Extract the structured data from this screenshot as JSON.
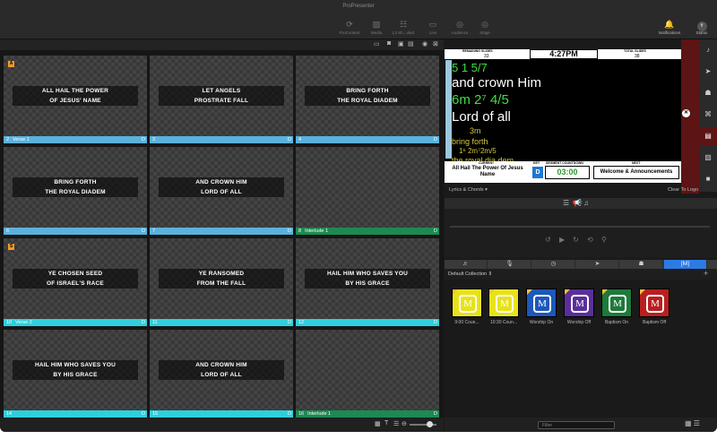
{
  "app_title": "ProPresenter",
  "toolbar": [
    {
      "label": "ProContent",
      "icon": "procontent-icon",
      "glyph": "⟳"
    },
    {
      "label": "Media",
      "icon": "media-icon",
      "glyph": "▨"
    },
    {
      "label": "L3 Sh...uled",
      "icon": "scheduled-icon",
      "glyph": "☷"
    },
    {
      "label": "Live",
      "icon": "live-icon",
      "glyph": "▭"
    },
    {
      "label": "Audience",
      "icon": "audience-icon",
      "glyph": "◎"
    },
    {
      "label": "Stage",
      "icon": "stage-icon",
      "glyph": "◎"
    }
  ],
  "toolbar_right": [
    {
      "label": "Notifications",
      "icon": "notifications-bell-icon",
      "glyph": "🔔"
    },
    {
      "label": "Status",
      "icon": "status-avatar-icon",
      "glyph": "ff"
    }
  ],
  "slides": [
    {
      "lines": [
        "ALL HAIL THE POWER",
        "OF JESUS' NAME"
      ],
      "index": "2",
      "group": "Verse 1",
      "color": "bl",
      "marker": "A"
    },
    {
      "lines": [
        "LET ANGELS",
        "PROSTRATE FALL"
      ],
      "index": "3",
      "group": "",
      "color": "bl",
      "marker": ""
    },
    {
      "lines": [
        "BRING FORTH",
        "THE ROYAL DIADEM"
      ],
      "index": "4",
      "group": "",
      "color": "bl",
      "marker": ""
    },
    {
      "lines": [
        "BRING FORTH",
        "THE ROYAL DIADEM"
      ],
      "index": "6",
      "group": "",
      "color": "bl",
      "marker": ""
    },
    {
      "lines": [
        "AND CROWN HIM",
        "LORD OF ALL"
      ],
      "index": "7",
      "group": "",
      "color": "bl",
      "marker": ""
    },
    {
      "lines": [],
      "index": "8",
      "group": "Interlude 1",
      "color": "gr",
      "marker": ""
    },
    {
      "lines": [
        "YE CHOSEN SEED",
        "OF ISRAEL'S RACE"
      ],
      "index": "10",
      "group": "Verse 2",
      "color": "cy",
      "marker": "S"
    },
    {
      "lines": [
        "YE RANSOMED",
        "FROM THE FALL"
      ],
      "index": "11",
      "group": "",
      "color": "cy",
      "marker": ""
    },
    {
      "lines": [
        "HAIL HIM WHO SAVES YOU",
        "BY HIS GRACE"
      ],
      "index": "12",
      "group": "",
      "color": "cy",
      "marker": ""
    },
    {
      "lines": [
        "HAIL HIM WHO SAVES YOU",
        "BY HIS GRACE"
      ],
      "index": "14",
      "group": "",
      "color": "cy",
      "marker": ""
    },
    {
      "lines": [
        "AND CROWN HIM",
        "LORD OF ALL"
      ],
      "index": "15",
      "group": "",
      "color": "cy",
      "marker": ""
    },
    {
      "lines": [],
      "index": "16",
      "group": "Interlude 1",
      "color": "gr",
      "marker": ""
    }
  ],
  "slide_badge": "D",
  "stage": {
    "remaining_label": "REMAINING SLIDES",
    "remaining_value": "33",
    "clock": "4:27PM",
    "total_label": "TOTAL SLIDES",
    "total_value": "38",
    "lines": [
      {
        "text": "5    1         5/7",
        "color": "#3ee03e"
      },
      {
        "text": "and crown Him",
        "color": "#ffffff"
      },
      {
        "text": "6m   2⁷ 4/5",
        "color": "#3ee03e"
      },
      {
        "text": "Lord of all",
        "color": "#ffffff"
      },
      {
        "text": "3m",
        "color": "#d6c93a"
      },
      {
        "text": "bring forth",
        "color": "#d6c93a"
      },
      {
        "text": "1⁶     2m⁷2m/5",
        "color": "#d6c93a"
      },
      {
        "text": "the royal dia  dem",
        "color": "#d6c93a"
      }
    ],
    "current_label": "CURRENT",
    "current_value": "All Hail The Power Of Jesus Name",
    "key_label": "KEY",
    "key_value": "D",
    "countdown_label": "SEGMENT COUNTDOWN",
    "countdown_value": "03:00",
    "next_label": "NEXT",
    "next_value": "Welcome & Announcements",
    "layout_select": "Lyrics & Chords ▾",
    "clear_label": "Clear To Logo"
  },
  "cue_tabs": [
    "♬",
    "🎙",
    "◷",
    "➤",
    "☗",
    "[M]"
  ],
  "collection": "Default Collection ⇕",
  "cues": [
    {
      "label": "9:00 Coun...",
      "bg": "#e8e21a"
    },
    {
      "label": "10:30 Coun...",
      "bg": "#e8e21a"
    },
    {
      "label": "Worship On",
      "bg": "#1e58b8"
    },
    {
      "label": "Worship Off",
      "bg": "#5a2f9a"
    },
    {
      "label": "Baptism On",
      "bg": "#1e7a3a"
    },
    {
      "label": "Baptism Off",
      "bg": "#b82020"
    }
  ],
  "filter_placeholder": "Filter",
  "colors": {
    "accent": "#2c7be5",
    "verse1": "#5ab2dc",
    "verse2": "#2ed0dc",
    "interlude": "#1c8a52",
    "clear_panel": "#5c1414"
  }
}
